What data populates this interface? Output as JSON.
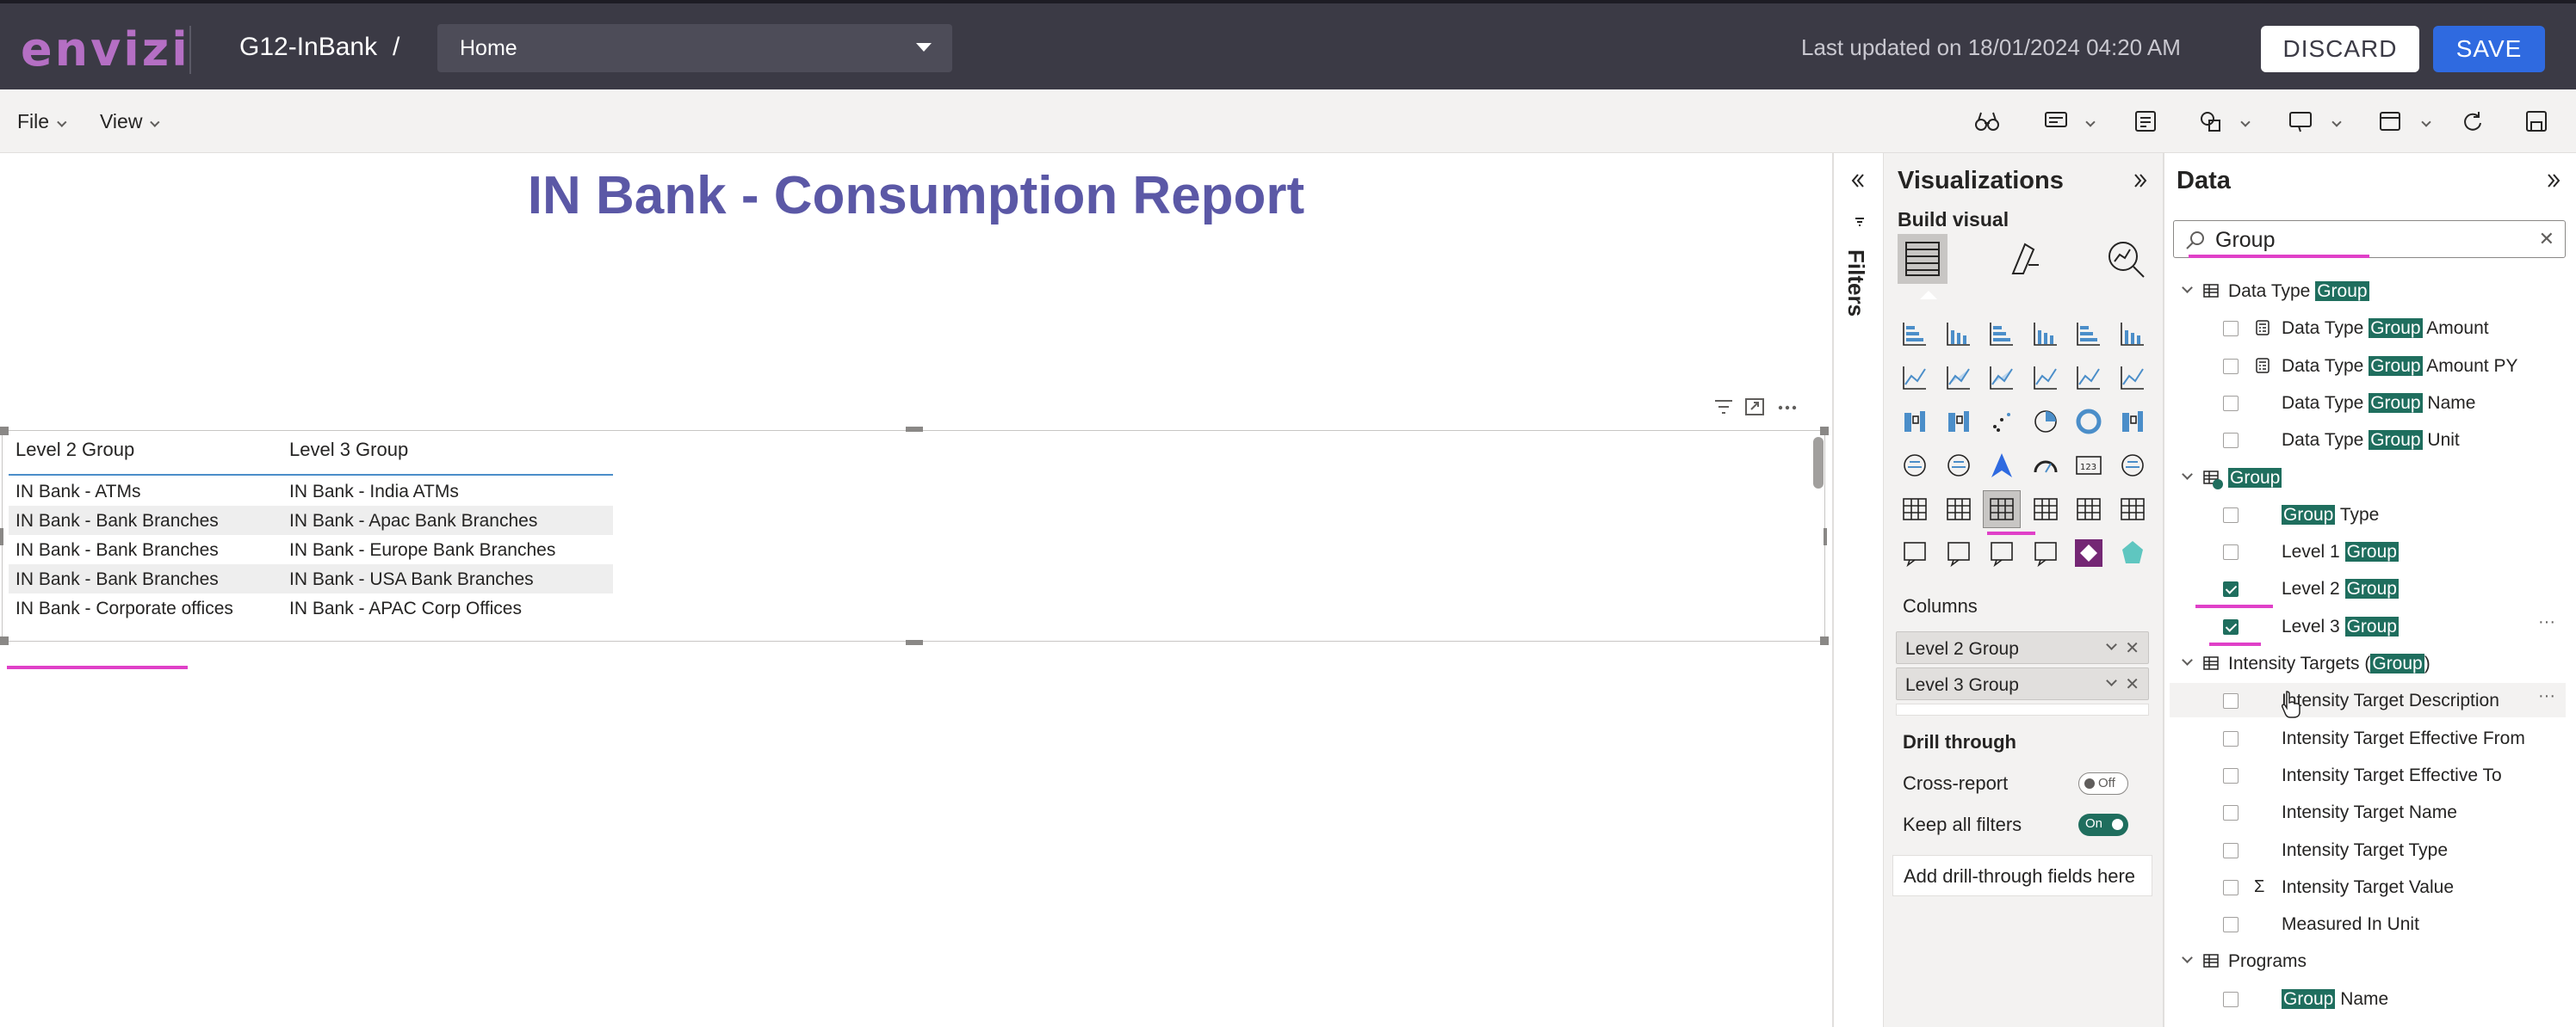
{
  "header": {
    "logo": "envizi",
    "workspace": "G12-InBank",
    "separator": "/",
    "page_select": "Home",
    "last_updated": "Last updated on 18/01/2024 04:20 AM",
    "discard_label": "DISCARD",
    "save_label": "SAVE"
  },
  "menubar": {
    "file_label": "File",
    "view_label": "View",
    "toolbar_icons": [
      "binoculars-icon",
      "comment-icon",
      "notes-icon",
      "shapes-icon",
      "present-icon",
      "layout-icon",
      "refresh-icon",
      "save-icon"
    ]
  },
  "canvas": {
    "report_title": "IN Bank - Consumption Report",
    "table": {
      "columns": [
        "Level 2 Group",
        "Level 3 Group"
      ],
      "rows": [
        [
          "IN Bank - ATMs",
          "IN Bank - India ATMs"
        ],
        [
          "IN Bank - Bank Branches",
          "IN Bank - Apac Bank Branches"
        ],
        [
          "IN Bank - Bank Branches",
          "IN Bank - Europe Bank Branches"
        ],
        [
          "IN Bank - Bank Branches",
          "IN Bank - USA Bank Branches"
        ],
        [
          "IN Bank - Corporate offices",
          "IN Bank - APAC Corp Offices"
        ]
      ]
    }
  },
  "filters": {
    "label": "Filters"
  },
  "visualizations": {
    "title": "Visualizations",
    "build_visual": "Build visual",
    "columns_label": "Columns",
    "column_fields": [
      "Level 2 Group",
      "Level 3 Group"
    ],
    "drill_through": "Drill through",
    "cross_report_label": "Cross-report",
    "cross_report_state": "Off",
    "keep_filters_label": "Keep all filters",
    "keep_filters_state": "On",
    "drill_placeholder": "Add drill-through fields here"
  },
  "data": {
    "title": "Data",
    "search_value": "Group",
    "tree": [
      {
        "level": 0,
        "pre": "Data Type ",
        "hl": "Group",
        "post": ""
      },
      {
        "level": 1,
        "checked": false,
        "icon": "calc",
        "pre": "Data Type ",
        "hl": "Group",
        "post": " Amount"
      },
      {
        "level": 1,
        "checked": false,
        "icon": "calc",
        "pre": "Data Type ",
        "hl": "Group",
        "post": " Amount PY"
      },
      {
        "level": 1,
        "checked": false,
        "icon": "",
        "pre": "Data Type ",
        "hl": "Group",
        "post": " Name"
      },
      {
        "level": 1,
        "checked": false,
        "icon": "",
        "pre": "Data Type ",
        "hl": "Group",
        "post": " Unit"
      },
      {
        "level": 0,
        "pre": "",
        "hl": "Group",
        "post": "",
        "active": true
      },
      {
        "level": 1,
        "checked": false,
        "icon": "",
        "pre": "",
        "hl": "Group",
        "post": " Type"
      },
      {
        "level": 1,
        "checked": false,
        "icon": "",
        "pre": "Level 1 ",
        "hl": "Group",
        "post": ""
      },
      {
        "level": 1,
        "checked": true,
        "icon": "",
        "pre": "Level 2 ",
        "hl": "Group",
        "post": ""
      },
      {
        "level": 1,
        "checked": true,
        "icon": "",
        "pre": "Level 3 ",
        "hl": "Group",
        "post": "",
        "more": true
      },
      {
        "level": 0,
        "pre": "Intensity Targets (",
        "hl": "Group",
        "post": ")"
      },
      {
        "level": 1,
        "checked": false,
        "icon": "",
        "pre": "Intensity Target Description",
        "hl": "",
        "post": "",
        "more": true,
        "hover": true
      },
      {
        "level": 1,
        "checked": false,
        "icon": "",
        "pre": "Intensity Target Effective From",
        "hl": "",
        "post": ""
      },
      {
        "level": 1,
        "checked": false,
        "icon": "",
        "pre": "Intensity Target Effective To",
        "hl": "",
        "post": ""
      },
      {
        "level": 1,
        "checked": false,
        "icon": "",
        "pre": "Intensity Target Name",
        "hl": "",
        "post": ""
      },
      {
        "level": 1,
        "checked": false,
        "icon": "",
        "pre": "Intensity Target Type",
        "hl": "",
        "post": ""
      },
      {
        "level": 1,
        "checked": false,
        "icon": "sigma",
        "pre": "Intensity Target Value",
        "hl": "",
        "post": ""
      },
      {
        "level": 1,
        "checked": false,
        "icon": "",
        "pre": "Measured In Unit",
        "hl": "",
        "post": ""
      },
      {
        "level": 0,
        "pre": "Programs",
        "hl": "",
        "post": ""
      },
      {
        "level": 1,
        "checked": false,
        "icon": "",
        "pre": "",
        "hl": "Group",
        "post": " Name"
      }
    ]
  },
  "colors": {
    "topbar": "#3b3a45",
    "accent_blue": "#2f6ae0",
    "title_purple": "#5b58a6",
    "highlight_green": "#1f6e5e",
    "annotation_pink": "#e040c8"
  }
}
